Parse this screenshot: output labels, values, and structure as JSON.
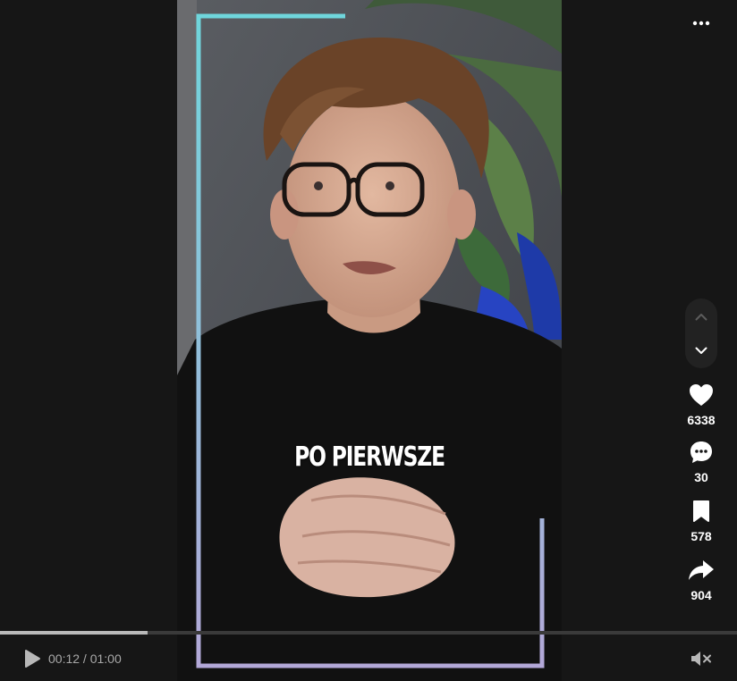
{
  "video": {
    "caption": "PO PIERWSZE",
    "frame_accent_top": "#6fd6dc",
    "frame_accent_bottom": "#b3a8d8"
  },
  "actions": {
    "likes": "6338",
    "comments": "30",
    "saves": "578",
    "shares": "904"
  },
  "playback": {
    "current_time": "00:12",
    "separator": " / ",
    "duration": "01:00",
    "progress": 0.2
  },
  "icons": [
    "more-horizontal",
    "chevron-up",
    "chevron-down",
    "heart",
    "comment",
    "bookmark",
    "share",
    "play",
    "mute"
  ]
}
